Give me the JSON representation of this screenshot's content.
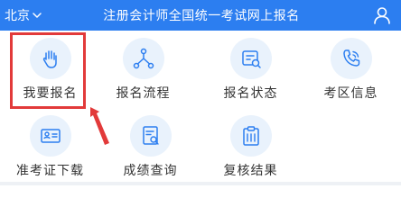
{
  "header": {
    "city": "北京",
    "title": "注册会计师全国统一考试网上报名"
  },
  "tiles": [
    {
      "label": "我要报名",
      "icon": "hand-icon"
    },
    {
      "label": "报名流程",
      "icon": "flow-icon"
    },
    {
      "label": "报名状态",
      "icon": "status-icon"
    },
    {
      "label": "考区信息",
      "icon": "phone-icon"
    },
    {
      "label": "准考证下载",
      "icon": "id-card-icon"
    },
    {
      "label": "成绩查询",
      "icon": "score-search-icon"
    },
    {
      "label": "复核结果",
      "icon": "clipboard-icon"
    }
  ],
  "colors": {
    "header_bg": "#2c7ef0",
    "icon": "#2c7ef0",
    "icon_bg": "#e9f2fc",
    "highlight": "#e23a3a"
  }
}
